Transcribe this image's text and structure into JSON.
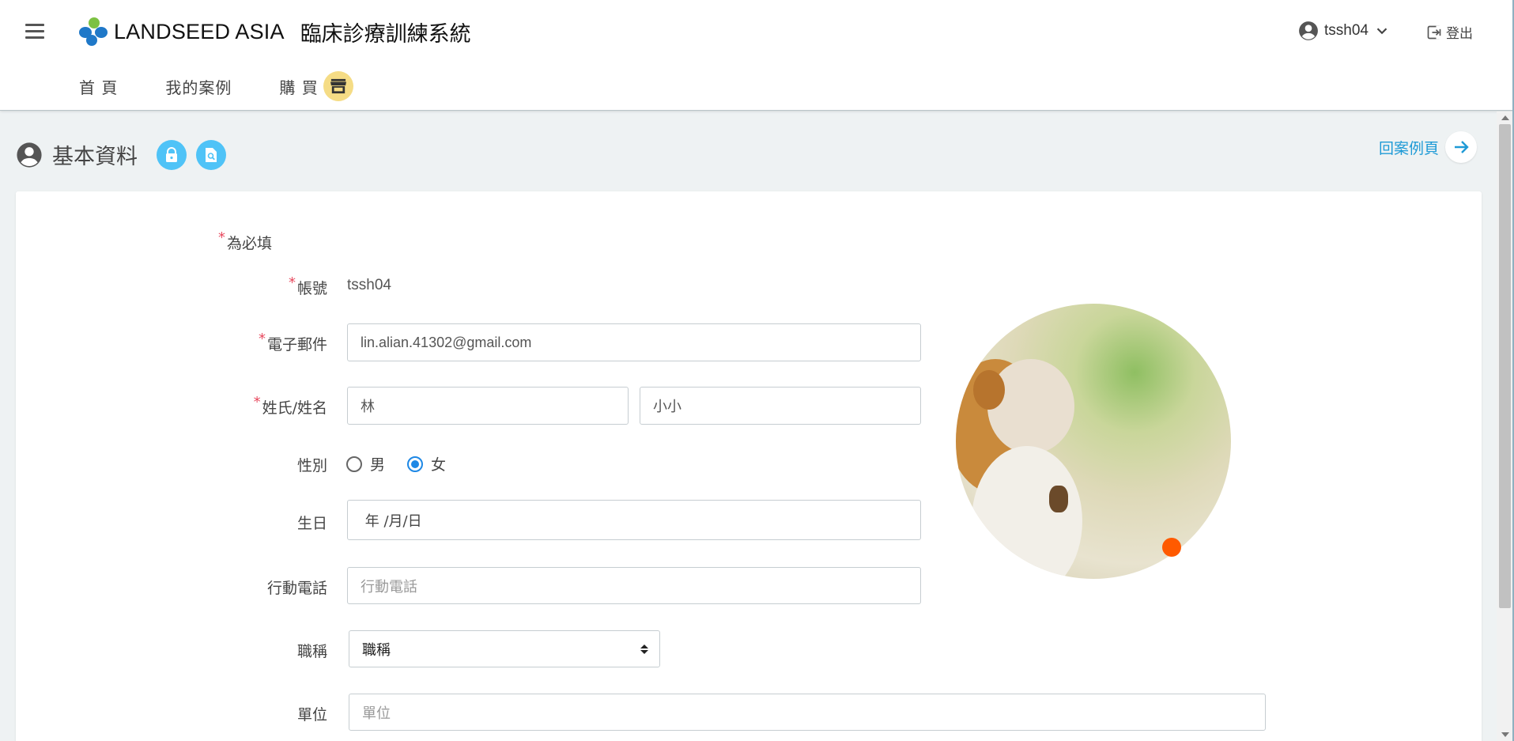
{
  "header": {
    "menu_icon": "hamburger-menu-icon",
    "brand_name": "LANDSEED ASIA",
    "system_name": "臨床診療訓練系統",
    "username": "tssh04",
    "logout_label": "登出"
  },
  "nav": {
    "items": [
      {
        "label": "首 頁"
      },
      {
        "label": "我的案例"
      },
      {
        "label": "購 買"
      }
    ],
    "shop_icon": "store-icon"
  },
  "page": {
    "title": "基本資料",
    "back_label": "回案例頁"
  },
  "form": {
    "required_note": "為必填",
    "account": {
      "label": "帳號",
      "value": "tssh04"
    },
    "email": {
      "label": "電子郵件",
      "value": "lin.alian.41302@gmail.com"
    },
    "name": {
      "label": "姓氏/姓名",
      "last_name": "林",
      "first_name": "小小"
    },
    "gender": {
      "label": "性別",
      "options": [
        "男",
        "女"
      ],
      "selected": "女"
    },
    "birthday": {
      "label": "生日",
      "value": " 年 /月/日"
    },
    "mobile": {
      "label": "行動電話",
      "placeholder": "行動電話"
    },
    "title": {
      "label": "職稱",
      "selected": "職稱"
    },
    "unit": {
      "label": "單位",
      "placeholder": "單位"
    }
  },
  "colors": {
    "accent_blue": "#1e9ad6",
    "circle_btn": "#4fc3f7",
    "shop_badge": "#f5dc85",
    "required": "#e84a5f",
    "avatar_edit": "#ff5a00"
  }
}
